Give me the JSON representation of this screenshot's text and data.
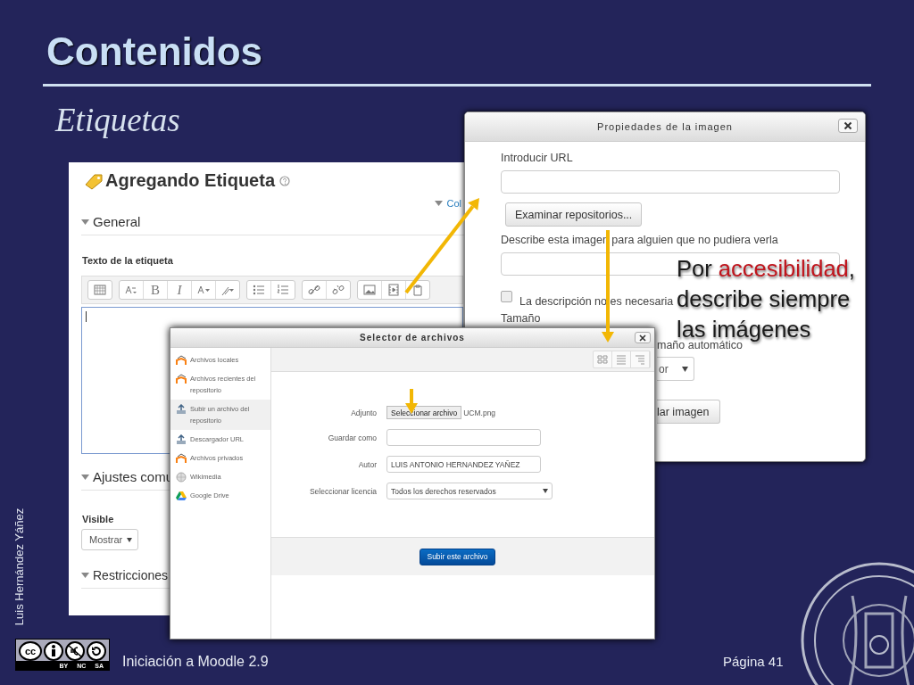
{
  "slide": {
    "title": "Contenidos",
    "subtitle": "Etiquetas",
    "author": "Luis Hernández Yáñez",
    "course": "Iniciación a Moodle 2.9",
    "page": "Página 41",
    "license": {
      "logo": "cc",
      "terms": [
        "BY",
        "NC",
        "SA"
      ]
    }
  },
  "editor_form": {
    "title": "Agregando Etiqueta",
    "collapse_link": "Col",
    "general": "General",
    "field_label": "Texto de la etiqueta",
    "toolbar": {
      "bold": "B",
      "italic": "I"
    },
    "common": "Ajustes comu",
    "visible_label": "Visible",
    "visible_select": "Mostrar",
    "restrictions": "Restricciones"
  },
  "image_dialog": {
    "title": "Propiedades de la imagen",
    "url_label": "Introducir URL",
    "browse_button": "Examinar repositorios...",
    "alt_label": "Describe esta imagen para alguien que no pudiera verla",
    "no_alt": {
      "label": "La descripción no es necesaria",
      "checked": false
    },
    "size_label": "Tamaño",
    "auto_size_label": "maño automático",
    "size_select": "or",
    "insert_button": "lar imagen"
  },
  "file_picker": {
    "title": "Selector de archivos",
    "repositories": [
      {
        "label": "Archivos locales",
        "kind": "moodle",
        "selected": false
      },
      {
        "label": "Archivos recientes del repositorio",
        "kind": "moodle",
        "selected": false
      },
      {
        "label": "Subir un archivo del repositorio",
        "kind": "upload",
        "selected": true
      },
      {
        "label": "Descargador URL",
        "kind": "upload",
        "selected": false
      },
      {
        "label": "Archivos privados",
        "kind": "moodle",
        "selected": false
      },
      {
        "label": "Wikimedia",
        "kind": "globe",
        "selected": false
      },
      {
        "label": "Google Drive",
        "kind": "drive",
        "selected": false
      }
    ],
    "attachment_label": "Adjunto",
    "choose_button": "Seleccionar archivo",
    "file_name": "UCM.png",
    "save_as_label": "Guardar como",
    "author_label": "Autor",
    "author_value": "LUIS ANTONIO HERNANDEZ YAÑEZ",
    "license_label": "Seleccionar licencia",
    "license_value": "Todos los derechos reservados",
    "upload_button": "Subir este archivo"
  },
  "callout": {
    "lines": [
      [
        {
          "text": "Por ",
          "highlight": false
        },
        {
          "text": "accesibilidad",
          "highlight": true
        },
        {
          "text": ",",
          "highlight": false
        }
      ],
      [
        {
          "text": "describe siempre",
          "highlight": false
        }
      ],
      [
        {
          "text": "las imágenes",
          "highlight": false
        }
      ]
    ]
  }
}
